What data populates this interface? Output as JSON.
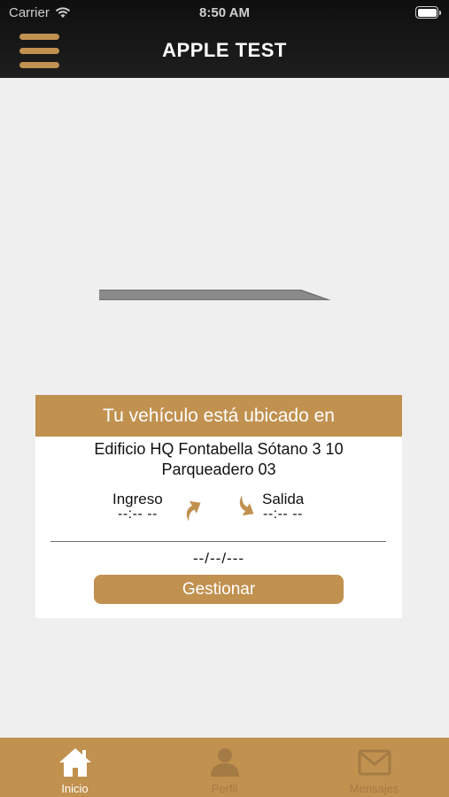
{
  "status_bar": {
    "carrier": "Carrier",
    "time": "8:50 AM"
  },
  "nav": {
    "title": "APPLE TEST",
    "menu_icon": "hamburger-menu-icon"
  },
  "colors": {
    "accent": "#c1914f",
    "nav_background": "#141414",
    "page_background": "#efeff0"
  },
  "card": {
    "header": "Tu vehículo está ubicado en",
    "location_line1": "Edificio HQ Fontabella Sótano 3 10",
    "location_line2": "Parqueadero 03",
    "ingreso_label": "Ingreso",
    "ingreso_value": "--:-- --",
    "salida_label": "Salida",
    "salida_value": "--:-- --",
    "date": "--/--/---",
    "manage_button": "Gestionar"
  },
  "tabbar": {
    "items": [
      {
        "label": "Inicio",
        "icon": "home-icon",
        "active": true
      },
      {
        "label": "Perfil",
        "icon": "person-icon",
        "active": false
      },
      {
        "label": "Mensajes",
        "icon": "envelope-icon",
        "active": false
      }
    ]
  }
}
